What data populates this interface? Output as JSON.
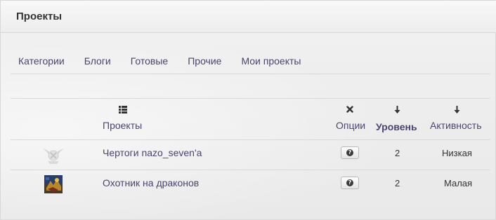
{
  "header": {
    "title": "Проекты"
  },
  "tabs": [
    {
      "label": "Категории"
    },
    {
      "label": "Блоги"
    },
    {
      "label": "Готовые"
    },
    {
      "label": "Прочие"
    },
    {
      "label": "Мои проекты"
    }
  ],
  "table": {
    "columns": {
      "project": {
        "label": "Проекты",
        "icon": "list-icon"
      },
      "options": {
        "label": "Опции",
        "icon": "cross-icon"
      },
      "level": {
        "label": "Уровень",
        "icon": "sort-down-arrow-icon",
        "sorted": true
      },
      "activity": {
        "label": "Активность",
        "icon": "sort-down-arrow-icon"
      }
    },
    "rows": [
      {
        "thumbnail": "emblem-placeholder-icon",
        "name": "Чертоги nazo_seven'a",
        "options_icon": "question-icon",
        "level": "2",
        "activity": "Низкая"
      },
      {
        "thumbnail": "game-art-thumbnail",
        "name": "Охотник на драконов",
        "options_icon": "question-icon",
        "level": "2",
        "activity": "Малая"
      }
    ]
  },
  "colors": {
    "link": "#4a4570",
    "text": "#333333",
    "background": "#ececec"
  }
}
